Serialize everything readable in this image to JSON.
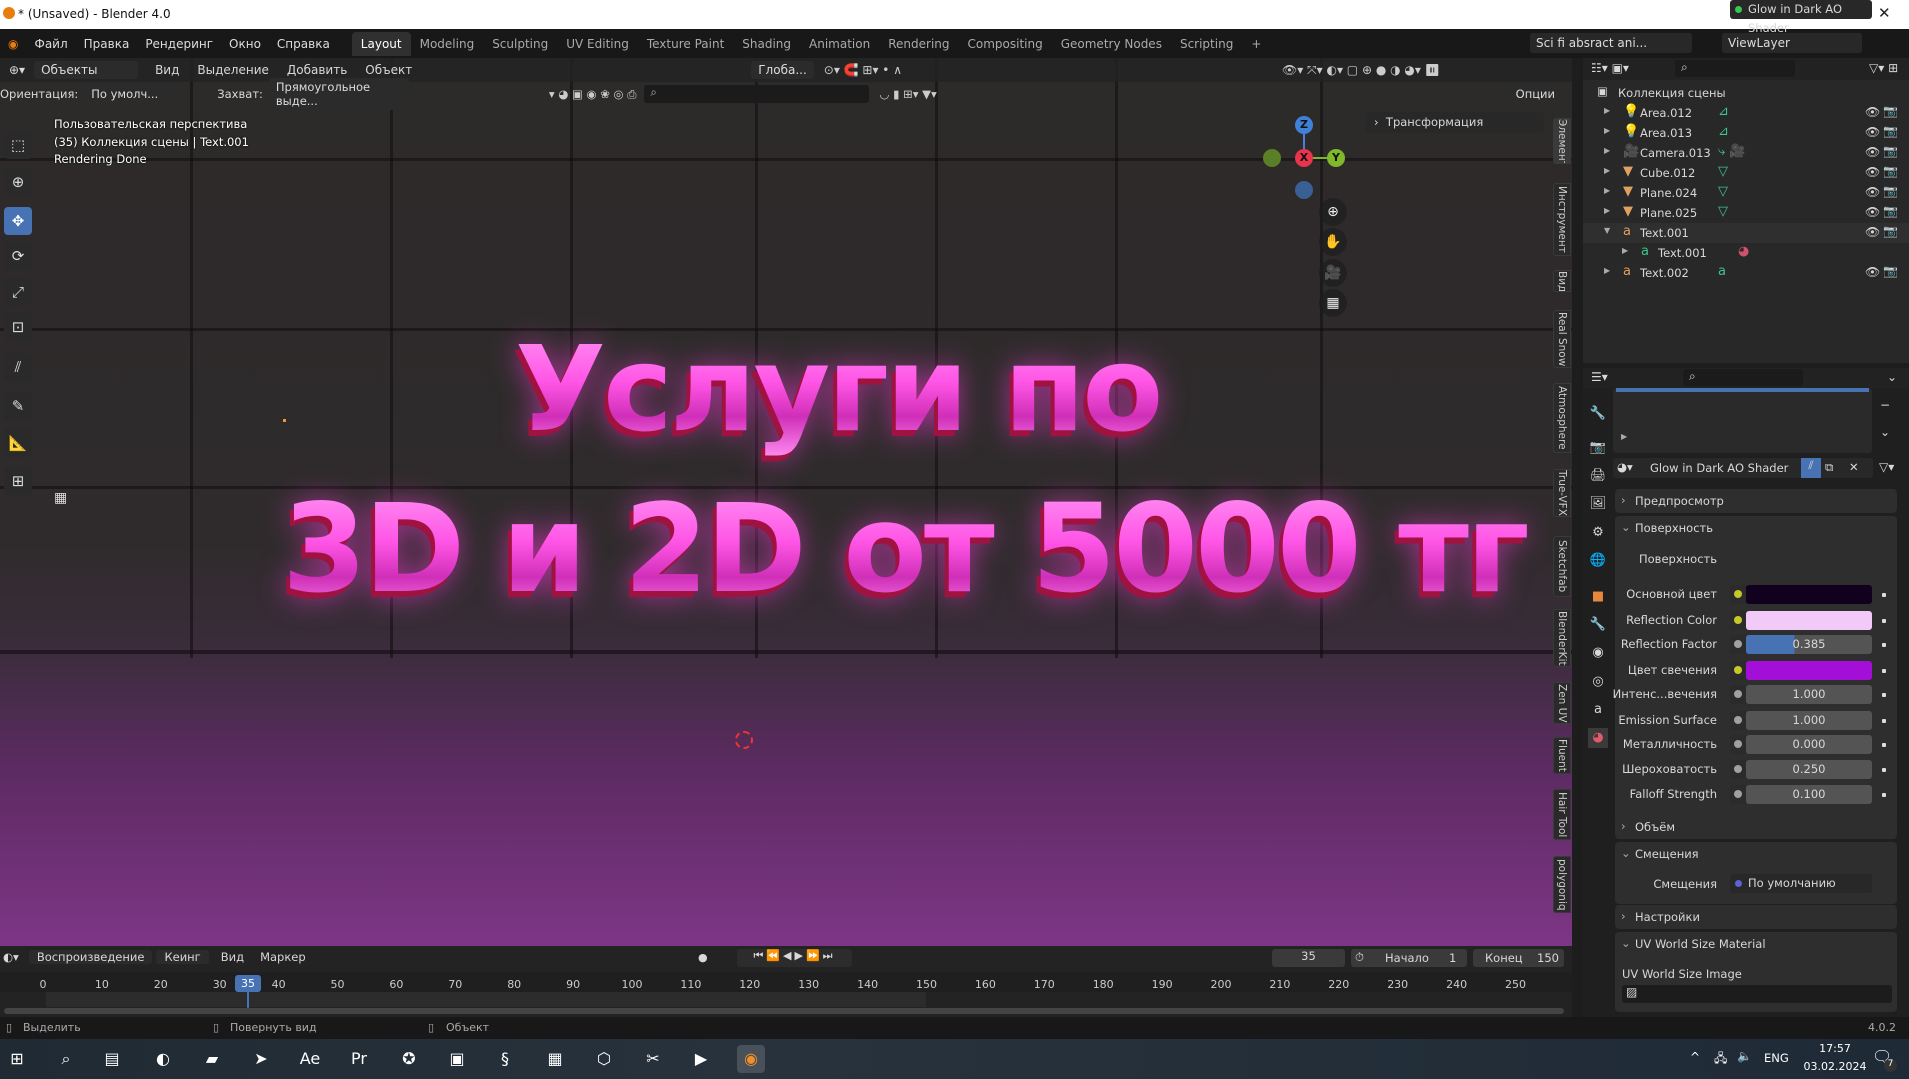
{
  "window": {
    "title": "* (Unsaved) - Blender 4.0",
    "minimize": "–",
    "maximize": "☐",
    "close": "✕"
  },
  "menu": {
    "items": [
      "Файл",
      "Правка",
      "Рендеринг",
      "Окно",
      "Справка"
    ],
    "workspaces": [
      "Layout",
      "Modeling",
      "Sculpting",
      "UV Editing",
      "Texture Paint",
      "Shading",
      "Animation",
      "Rendering",
      "Compositing",
      "Geometry Nodes",
      "Scripting",
      "+"
    ],
    "active_workspace": "Layout",
    "scene": "Sci fi absract ani...",
    "view_layer": "ViewLayer"
  },
  "viewport_header": {
    "mode": "Объекты",
    "items": [
      "Вид",
      "Выделение",
      "Добавить",
      "Объект"
    ],
    "transform_orientation": "Глоба...",
    "orientation_label": "Ориентация:",
    "orientation_value": "По умолч...",
    "snap_label": "Захват:",
    "snap_value": "Прямоугольное выде...",
    "options": "Опции"
  },
  "viewport": {
    "overlay_lines": [
      "Пользовательская перспектива",
      "(35) Коллекция сцены | Text.001",
      "Rendering Done"
    ],
    "scene_text_line1": "Услуги по",
    "scene_text_line2": "3D и 2D от 5000 тг",
    "gizmo": {
      "x": "X",
      "y": "Y",
      "z": "Z"
    },
    "sidebar_panel": "Трансформация",
    "sidebar_tabs": [
      "Элемент",
      "Инструмент",
      "Вид",
      "Real Snow",
      "Atmosphere",
      "True-VFX",
      "Sketchfab",
      "BlenderKit",
      "Zen UV",
      "Fluent",
      "Hair Tool",
      "polygoniq"
    ]
  },
  "outliner": {
    "root": "Коллекция сцены",
    "rows": [
      {
        "name": "Area.012",
        "type": "light"
      },
      {
        "name": "Area.013",
        "type": "light"
      },
      {
        "name": "Camera.013",
        "type": "camera"
      },
      {
        "name": "Cube.012",
        "type": "mesh"
      },
      {
        "name": "Plane.024",
        "type": "mesh"
      },
      {
        "name": "Plane.025",
        "type": "mesh"
      },
      {
        "name": "Text.001",
        "type": "text",
        "expanded": true
      },
      {
        "name": "Text.001",
        "type": "text-data",
        "child": true
      },
      {
        "name": "Text.002",
        "type": "text"
      }
    ]
  },
  "properties": {
    "material_name": "Glow in Dark AO Shader",
    "sections": {
      "preview": "Предпросмотр",
      "surface": "Поверхность",
      "volume": "Объём",
      "displacement": "Смещения",
      "settings": "Настройки",
      "uv_material": "UV World Size Material"
    },
    "surface_label": "Поверхность",
    "surface_value": "Glow in Dark AO Shader",
    "rows": [
      {
        "label": "Основной цвет",
        "type": "color",
        "color": "#12001f"
      },
      {
        "label": "Reflection Color",
        "type": "color",
        "color": "#f1caf7"
      },
      {
        "label": "Reflection Factor",
        "type": "slider",
        "value": "0.385",
        "fraction": 0.385
      },
      {
        "label": "Цвет свечения",
        "type": "color",
        "color": "#a30fd6"
      },
      {
        "label": "Интенс...вечения",
        "type": "number",
        "value": "1.000"
      },
      {
        "label": "Emission Surface",
        "type": "number",
        "value": "1.000"
      },
      {
        "label": "Металличность",
        "type": "number",
        "value": "0.000"
      },
      {
        "label": "Шероховатость",
        "type": "number",
        "value": "0.250"
      },
      {
        "label": "Falloff Strength",
        "type": "number",
        "value": "0.100"
      }
    ],
    "displacement_label": "Смещения",
    "displacement_value": "По умолчанию",
    "uv_image_label": "UV World Size Image"
  },
  "timeline": {
    "menus": [
      "Воспроизведение",
      "Кеинг",
      "Вид",
      "Маркер"
    ],
    "current_frame": "35",
    "start_label": "Начало",
    "start": "1",
    "end_label": "Конец",
    "end": "150",
    "ticks": [
      "0",
      "10",
      "20",
      "30",
      "40",
      "50",
      "60",
      "70",
      "80",
      "90",
      "100",
      "110",
      "120",
      "130",
      "140",
      "150",
      "160",
      "170",
      "180",
      "190",
      "200",
      "210",
      "220",
      "230",
      "240",
      "250"
    ]
  },
  "statusbar": {
    "select": "Выделить",
    "rotate": "Повернуть вид",
    "object": "Объект",
    "version": "4.0.2"
  },
  "taskbar": {
    "apps": [
      "start",
      "search",
      "task-view",
      "edge",
      "explorer",
      "telegram",
      "after-effects",
      "premiere",
      "app",
      "media",
      "app2",
      "winrar",
      "box-app",
      "capcut",
      "player",
      "blender"
    ],
    "lang": "ENG",
    "time": "17:57",
    "date": "03.02.2024",
    "notifications": "7"
  }
}
